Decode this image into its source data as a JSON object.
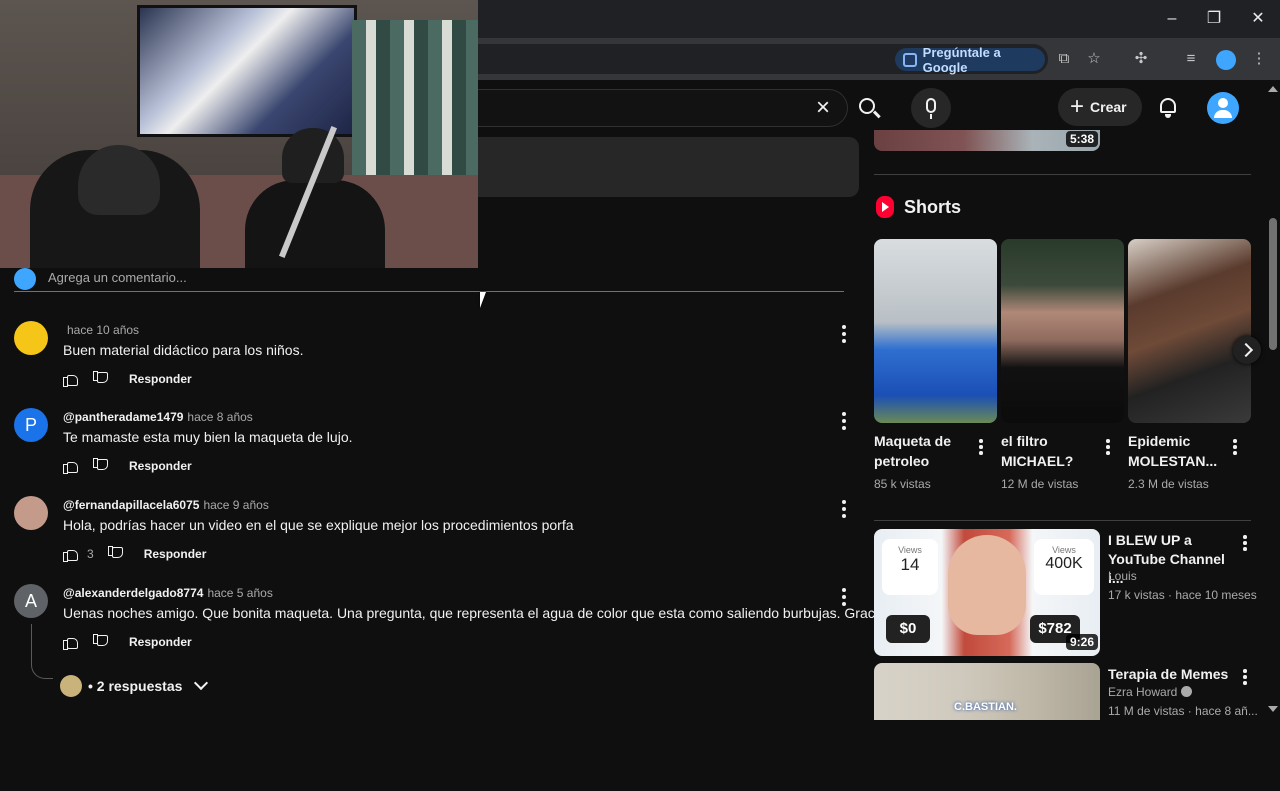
{
  "browser": {
    "ask_google_label": "Pregúntale a Google",
    "window_controls": [
      "minimize",
      "restore",
      "close"
    ]
  },
  "header": {
    "create_label": "Crear"
  },
  "comments": {
    "placeholder": "Agrega un comentario...",
    "reply_label": "Responder",
    "items": [
      {
        "user": "",
        "time": "hace 10 años",
        "text": "Buen material didáctico para los niños.",
        "likes": "",
        "avatar_letter": "",
        "avatar_color": "#f5c518"
      },
      {
        "user": "@pantheradame1479",
        "time": "hace 8 años",
        "text": "Te mamaste esta muy bien la maqueta de lujo.",
        "likes": "",
        "avatar_letter": "P",
        "avatar_color": "#1a73e8"
      },
      {
        "user": "@fernandapillacela6075",
        "time": "hace 9 años",
        "text": "Hola, podrías hacer un video en el que se explique mejor los procedimientos porfa",
        "likes": "3",
        "avatar_letter": "",
        "avatar_color": "#c49a8a"
      },
      {
        "user": "@alexanderdelgado8774",
        "time": "hace 5 años",
        "text": "Uenas noches amigo. Que bonita maqueta. Una pregunta, que representa el agua de color que esta como saliendo burbujas. Gracias",
        "likes": "",
        "avatar_letter": "A",
        "avatar_color": "#5f6368"
      }
    ],
    "replies_label": "• 2 respuestas"
  },
  "sidebar": {
    "top_video_duration": "5:38",
    "shorts_heading": "Shorts",
    "shorts": [
      {
        "title": "Maqueta de petroleo",
        "views": "85 k vistas"
      },
      {
        "title": "el filtro MICHAEL?",
        "views": "12 M de vistas"
      },
      {
        "title": "Epidemic MOLESTAN...",
        "views": "2.3 M de vistas"
      }
    ],
    "videos": [
      {
        "title": "I BLEW UP a YouTube Channel i...",
        "channel": "Louis",
        "stats": "17 k vistas · hace 10 meses",
        "duration": "9:26",
        "thumb_views_left_label": "Views",
        "thumb_views_left": "14",
        "thumb_views_right_label": "Views",
        "thumb_views_right": "400K",
        "thumb_money_left": "$0",
        "thumb_money_right": "$782"
      },
      {
        "title": "Terapia de Memes",
        "channel": "Ezra Howard",
        "stats": "11 M de vistas · hace 8 añ...",
        "thumb_caption": "C.BASTIAN."
      }
    ]
  }
}
